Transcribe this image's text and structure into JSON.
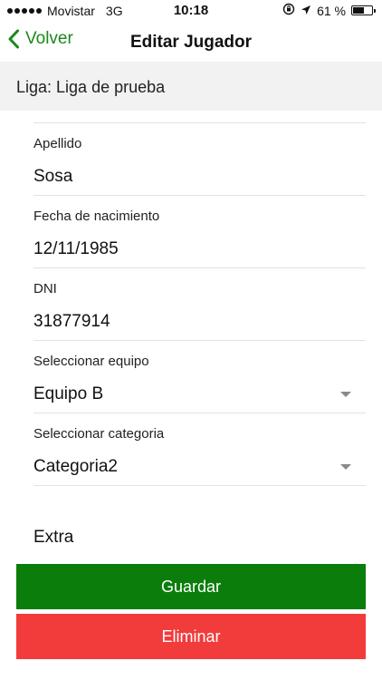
{
  "status_bar": {
    "carrier": "Movistar",
    "network": "3G",
    "time": "10:18",
    "battery_text": "61 %",
    "battery_level": 0.61
  },
  "nav": {
    "back_label": "Volver",
    "title": "Editar Jugador"
  },
  "league": {
    "text": "Liga: Liga de prueba"
  },
  "fields": [
    {
      "label": "Apellido",
      "value": "Sosa"
    },
    {
      "label": "Fecha de nacimiento",
      "value": "12/11/1985"
    },
    {
      "label": "DNI",
      "value": "31877914"
    },
    {
      "label": "Seleccionar equipo",
      "value": "Equipo B"
    },
    {
      "label": "Seleccionar categoria",
      "value": "Categoria2"
    }
  ],
  "extra_label": "Extra",
  "buttons": {
    "save": "Guardar",
    "delete": "Eliminar"
  },
  "colors": {
    "accent": "#1a8a1a",
    "save": "#0b7d0b",
    "delete": "#f23b3b"
  }
}
